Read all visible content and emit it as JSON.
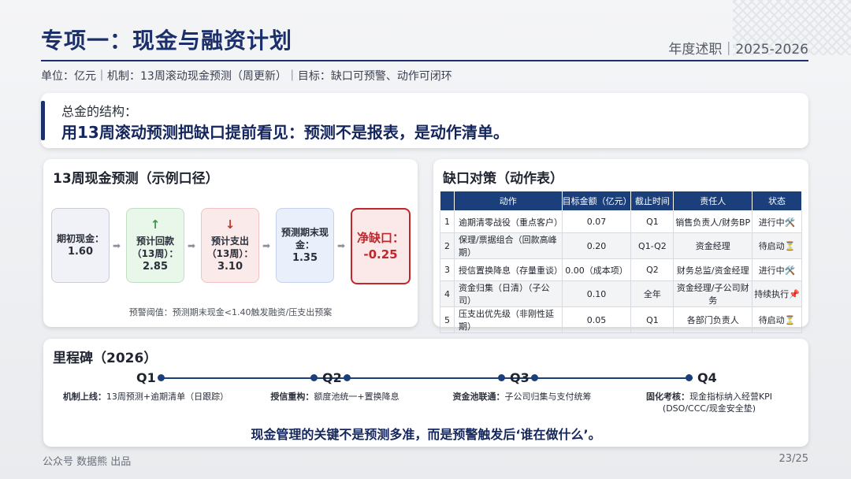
{
  "header": {
    "title": "专项一：现金与融资计划",
    "right": "年度述职｜2025-2026",
    "subtitle": "单位：亿元｜机制：13周滚动现金预测（周更新）｜目标：缺口可预警、动作可闭环"
  },
  "summary": {
    "lead": "总金的结构：",
    "main": "用13周滚动预测把缺口提前看见：预测不是报表，是动作清单。"
  },
  "forecast": {
    "title": "13周现金预测（示例口径）",
    "boxes": [
      {
        "label": "期初现金：",
        "value": "1.60"
      },
      {
        "label": "预计回款（13周）：",
        "value": "2.85"
      },
      {
        "label": "预计支出（13周）：",
        "value": "3.10"
      },
      {
        "label": "预测期末现金：",
        "value": "1.35"
      },
      {
        "label": "净缺口：",
        "value": "-0.25"
      }
    ],
    "note": "预警阈值：预测期末现金<1.40触发融资/压支出预案"
  },
  "gap": {
    "title": "缺口对策（动作表）",
    "headers": [
      "",
      "动作",
      "目标金额（亿元）",
      "截止时间",
      "责任人",
      "状态"
    ],
    "rows": [
      {
        "n": "1",
        "action": "逾期清零战役（重点客户）",
        "amount": "0.07",
        "due": "Q1",
        "owner": "销售负责人/财务BP",
        "status": "进行中🛠️"
      },
      {
        "n": "2",
        "action": "保理/票据组合（回款高峰期）",
        "amount": "0.20",
        "due": "Q1-Q2",
        "owner": "资金经理",
        "status": "待启动⏳"
      },
      {
        "n": "3",
        "action": "授信置换降息（存量重谈）",
        "amount": "0.00（成本项）",
        "due": "Q2",
        "owner": "财务总监/资金经理",
        "status": "进行中🛠️"
      },
      {
        "n": "4",
        "action": "资金归集（日清）（子公司）",
        "amount": "0.10",
        "due": "全年",
        "owner": "资金经理/子公司财务",
        "status": "持续执行📌"
      },
      {
        "n": "5",
        "action": "压支出优先级（非刚性延期）",
        "amount": "0.05",
        "due": "Q1",
        "owner": "各部门负责人",
        "status": "待启动⏳"
      }
    ]
  },
  "milestones": {
    "title": "里程碑（2026）",
    "items": [
      {
        "q": "Q1",
        "head": "机制上线：",
        "text": "13周预测+逾期清单（日跟踪）",
        "extra": ""
      },
      {
        "q": "Q2",
        "head": "授信重构：",
        "text": "额度池统一+置换降息",
        "extra": ""
      },
      {
        "q": "Q3",
        "head": "资金池联通：",
        "text": "子公司归集与支付统筹",
        "extra": ""
      },
      {
        "q": "Q4",
        "head": "固化考核：",
        "text": "现金指标纳入经营KPI",
        "extra": "(DSO/CCC/现金安全垫)"
      }
    ],
    "closing": "现金管理的关键不是预测多准，而是预警触发后‘谁在做什么’。"
  },
  "footer": {
    "left": "公众号 数据熊 出品",
    "right": "23/25"
  }
}
